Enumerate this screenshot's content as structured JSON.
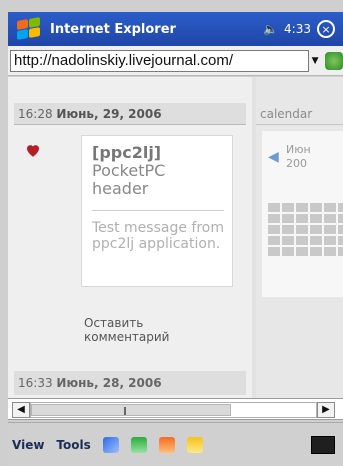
{
  "window": {
    "title": "Internet Explorer",
    "time": "4:33"
  },
  "address": {
    "url": "http://nadolinskiy.livejournal.com/"
  },
  "page": {
    "post1": {
      "time": "16:28",
      "date": "Июнь, 29, 2006",
      "title_tag": "[ppc2lj]",
      "title_rest": "PocketPC header",
      "body": "Test message from ppc2lj application.",
      "comment_link": "Оставить комментарий"
    },
    "post2": {
      "time": "16:33",
      "date": "Июнь, 28, 2006"
    },
    "calendar": {
      "heading": "calendar",
      "month_line1": "Июн",
      "month_line2": "200"
    }
  },
  "taskbar": {
    "view": "View",
    "tools": "Tools"
  },
  "colors": {
    "titlebar": "#2c5dca",
    "taskbar": "#d0d0d0",
    "accent": "#6c9bd1"
  },
  "icons": {
    "windows_logo": "windows-logo-icon",
    "speaker": "speaker-icon",
    "close": "close-icon",
    "go": "go-icon",
    "mood": "mood-icon",
    "calendar_prev": "chevron-left-icon",
    "scroll_left": "chevron-left-icon",
    "scroll_right": "chevron-right-icon",
    "nav_blue": "blue-diamond-icon",
    "nav_green": "green-page-icon",
    "nav_orange": "orange-home-icon",
    "nav_yellow": "yellow-star-icon",
    "keyboard": "keyboard-icon"
  }
}
